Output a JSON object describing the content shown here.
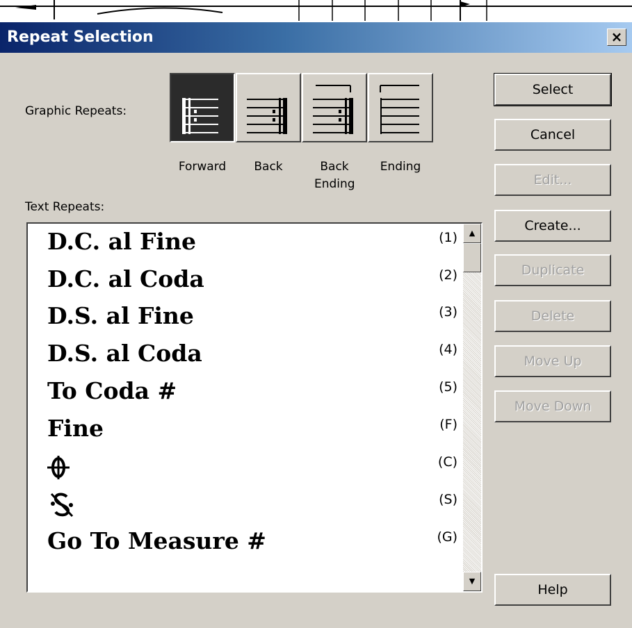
{
  "dialog": {
    "title": "Repeat Selection",
    "close_glyph": "×"
  },
  "graphic_repeats": {
    "label": "Graphic Repeats:",
    "options": [
      {
        "label": "Forward",
        "icon": "forward-repeat-icon",
        "selected": true
      },
      {
        "label": "Back",
        "icon": "back-repeat-icon",
        "selected": false
      },
      {
        "label": "Back Ending",
        "icon": "back-ending-repeat-icon",
        "selected": false
      },
      {
        "label": "Ending",
        "icon": "ending-repeat-icon",
        "selected": false
      }
    ]
  },
  "text_repeats": {
    "label": "Text Repeats:",
    "items": [
      {
        "name": "D.C. al Fine",
        "key": "(1)"
      },
      {
        "name": "D.C. al Coda",
        "key": "(2)"
      },
      {
        "name": "D.S. al Fine",
        "key": "(3)"
      },
      {
        "name": "D.S. al Coda",
        "key": "(4)"
      },
      {
        "name": "To Coda #",
        "key": "(5)"
      },
      {
        "name": "Fine",
        "key": "(F)"
      },
      {
        "name": "",
        "key": "(C)",
        "icon": "coda-symbol-icon"
      },
      {
        "name": "",
        "key": "(S)",
        "icon": "segno-symbol-icon"
      },
      {
        "name": "Go To Measure #",
        "key": "(G)"
      }
    ]
  },
  "buttons": {
    "select": "Select",
    "cancel": "Cancel",
    "edit": "Edit...",
    "create": "Create...",
    "duplicate": "Duplicate",
    "delete": "Delete",
    "move_up": "Move Up",
    "move_down": "Move Down",
    "help": "Help"
  },
  "button_states": {
    "select": "enabled",
    "cancel": "enabled",
    "edit": "disabled",
    "create": "enabled",
    "duplicate": "disabled",
    "delete": "disabled",
    "move_up": "disabled",
    "move_down": "disabled",
    "help": "enabled"
  },
  "scrollbar": {
    "up_glyph": "▲",
    "down_glyph": "▼"
  }
}
